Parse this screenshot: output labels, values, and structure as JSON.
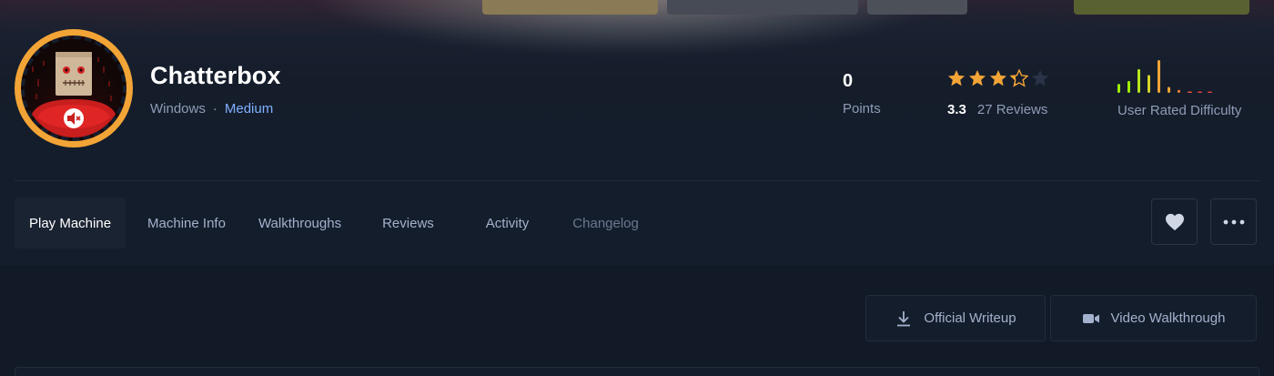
{
  "machine": {
    "name": "Chatterbox",
    "os": "Windows",
    "separator": "·",
    "difficulty": "Medium",
    "avatar_icon": "paper-bag-head-icon"
  },
  "stats": {
    "points_value": "0",
    "points_label": "Points",
    "rating_value": "3.3",
    "rating_fraction": 0.66,
    "stars_total": 5,
    "reviews": "27 Reviews",
    "difficulty_label": "User Rated Difficulty",
    "difficulty_distribution": [
      3,
      4,
      8,
      6,
      11,
      2,
      1,
      0,
      0,
      0
    ]
  },
  "tabs": [
    {
      "label": "Play Machine",
      "active": true
    },
    {
      "label": "Machine Info",
      "active": false
    },
    {
      "label": "Walkthroughs",
      "active": false
    },
    {
      "label": "Reviews",
      "active": false
    },
    {
      "label": "Activity",
      "active": false
    },
    {
      "label": "Changelog",
      "active": false
    }
  ],
  "actions": {
    "favorite_icon": "heart-icon",
    "more_icon": "more-dots-icon",
    "writeup_label": "Official Writeup",
    "writeup_icon": "download-icon",
    "video_label": "Video Walkthrough",
    "video_icon": "video-camera-icon"
  },
  "colors": {
    "background": "#141d2b",
    "accent_orange": "#f3a436",
    "medium_blue": "#7eb0ff",
    "star_gold": "#f3a436",
    "difficulty_gradient": [
      "#9fef00",
      "#9fef00",
      "#b6e61c",
      "#d5d52a",
      "#f3a436",
      "#f3a436",
      "#f08235",
      "#e8573a",
      "#e33d3d",
      "#e33d3d"
    ]
  }
}
